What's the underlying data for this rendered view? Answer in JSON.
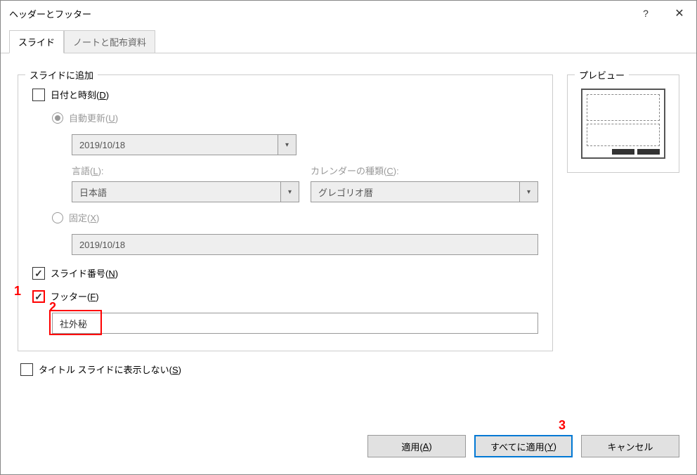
{
  "title": "ヘッダーとフッター",
  "tabs": {
    "slide": "スライド",
    "notes": "ノートと配布資料"
  },
  "groupbox": {
    "title": "スライドに追加"
  },
  "datetime": {
    "label": "日付と時刻(",
    "key": "D",
    "suffix": ")",
    "auto_label": "自動更新(",
    "auto_key": "U",
    "auto_suffix": ")",
    "date_value": "2019/10/18",
    "lang_label": "言語(",
    "lang_key": "L",
    "lang_suffix": "):",
    "lang_value": "日本語",
    "cal_label": "カレンダーの種類(",
    "cal_key": "C",
    "cal_suffix": "):",
    "cal_value": "グレゴリオ暦",
    "fixed_label": "固定(",
    "fixed_key": "X",
    "fixed_suffix": ")",
    "fixed_value": "2019/10/18"
  },
  "slidenum": {
    "label": "スライド番号(",
    "key": "N",
    "suffix": ")"
  },
  "footer": {
    "label": "フッター(",
    "key": "F",
    "suffix": ")",
    "value": "社外秘"
  },
  "notitle": {
    "label": "タイトル スライドに表示しない(",
    "key": "S",
    "suffix": ")"
  },
  "preview": {
    "title": "プレビュー"
  },
  "buttons": {
    "apply": "適用(",
    "apply_key": "A",
    "apply_suffix": ")",
    "apply_all": "すべてに適用(",
    "apply_all_key": "Y",
    "apply_all_suffix": ")",
    "cancel": "キャンセル"
  },
  "annotations": {
    "n1": "1",
    "n2": "2",
    "n3": "3"
  }
}
